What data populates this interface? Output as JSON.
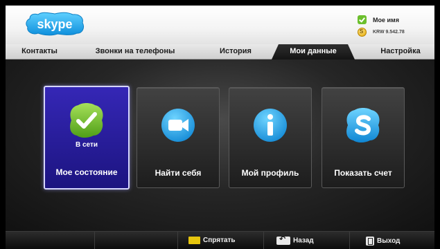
{
  "header": {
    "logo_text": "skype",
    "user": {
      "name": "Мое имя",
      "credit": "KRW 9.542.78",
      "credit_icon_glyph": "S",
      "status_icon": "online-check-icon"
    }
  },
  "tabs": [
    {
      "label": "Контакты",
      "active": false
    },
    {
      "label": "Звонки на телефоны",
      "active": false
    },
    {
      "label": "История",
      "active": false
    },
    {
      "label": "Мои данные",
      "active": true
    },
    {
      "label": "Настройка",
      "active": false
    }
  ],
  "tiles": [
    {
      "label": "Мое состояние",
      "sublabel": "В сети",
      "icon": "online-check-icon",
      "selected": true
    },
    {
      "label": "Найти себя",
      "icon": "video-camera-icon",
      "selected": false
    },
    {
      "label": "Мой профиль",
      "icon": "info-icon",
      "selected": false
    },
    {
      "label": "Показать счет",
      "icon": "skype-credit-icon",
      "selected": false
    }
  ],
  "bottom_bar": {
    "hide": {
      "label": "Спрятать",
      "key": "yellow-key-icon"
    },
    "back": {
      "label": "Назад",
      "key": "return-key-icon"
    },
    "exit": {
      "label": "Выход",
      "key": "exit-key-icon"
    }
  },
  "colors": {
    "selected_tile": "#2a1fa0",
    "online_green": "#6cbf2d",
    "skype_blue": "#1ea0e6",
    "yellow_key": "#e6c50e"
  }
}
